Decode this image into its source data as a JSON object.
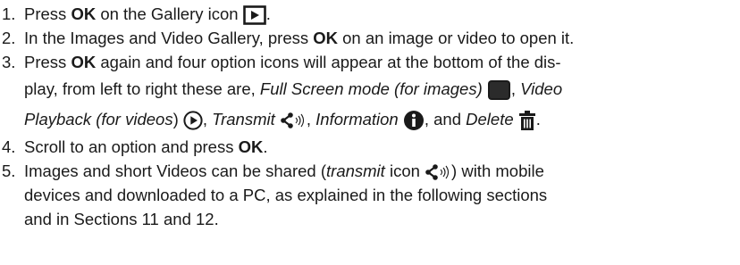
{
  "steps": [
    {
      "num": "1.",
      "t1": "Press ",
      "b1": "OK",
      "t2": " on the Gallery icon ",
      "t3": "."
    },
    {
      "num": "2.",
      "t1": "In the Images and Video Gallery, press ",
      "b1": "OK",
      "t2": " on an image or video to open it."
    },
    {
      "num": "3.",
      "t1": "Press ",
      "b1": "OK",
      "t2": " again and four option icons will appear at the bottom of the dis-",
      "t3": "play, from left to right these are, ",
      "i1": "Full Screen mode (for images)",
      "t4": ", ",
      "i2": "Video",
      "i3": "Playback (for videos",
      "t5": ")",
      "t6": ", ",
      "i4": "Transmit",
      "t7": ", ",
      "i5": "Information",
      "t8": ", and ",
      "i6": "Delete",
      "t9": "."
    },
    {
      "num": "4.",
      "t1": "Scroll to an option and press ",
      "b1": "OK",
      "t2": "."
    },
    {
      "num": "5.",
      "t1": "Images and short Videos can be shared (",
      "i1": "transmit",
      "t2": " icon ",
      "t3": ") with mobile",
      "line2": "devices and downloaded to a PC, as explained in the following sections",
      "line3": "and in Sections 11 and 12."
    }
  ],
  "icons": {
    "gallery": "gallery-icon",
    "fullscreen": "fullscreen-icon",
    "video_playback": "play-circle-icon",
    "transmit": "transmit-icon",
    "information": "info-icon",
    "delete": "trash-icon"
  }
}
